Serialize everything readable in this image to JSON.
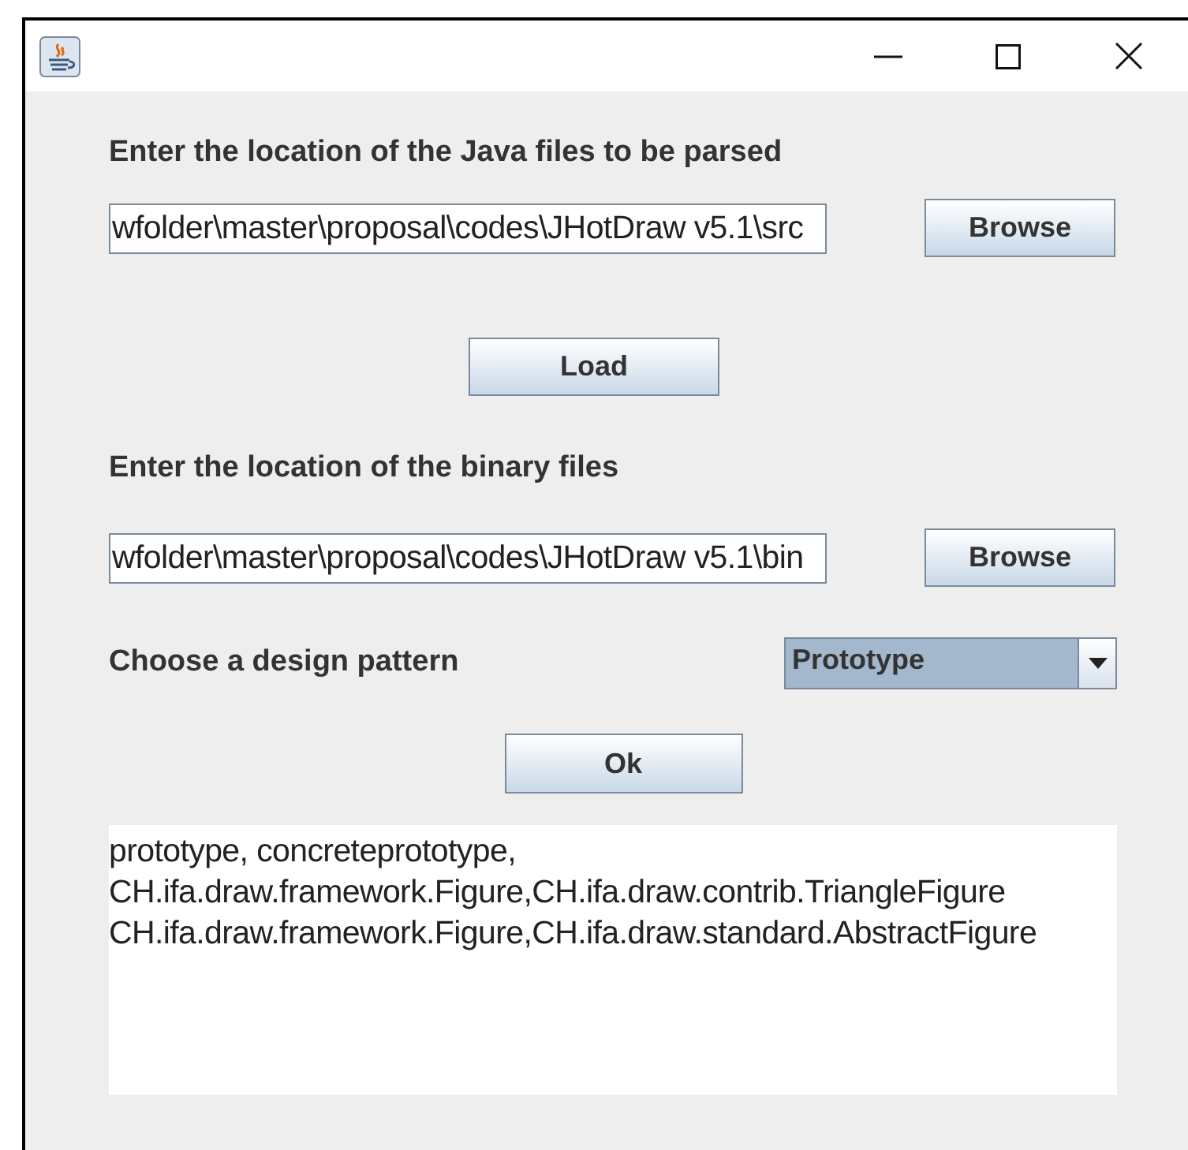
{
  "window": {
    "title_bar_buttons": [
      {
        "kind": "minimize"
      },
      {
        "kind": "maximize"
      },
      {
        "kind": "close"
      }
    ]
  },
  "source_section": {
    "label": "Enter the location of the Java files to be parsed",
    "path": "wfolder\\master\\proposal\\codes\\JHotDraw v5.1\\src",
    "browse_button": "Browse"
  },
  "load_button": "Load",
  "binary_section": {
    "label": "Enter the location of the binary files",
    "path": "wfolder\\master\\proposal\\codes\\JHotDraw v5.1\\bin",
    "browse_button": "Browse"
  },
  "pattern": {
    "label": "Choose a design pattern",
    "value": "Prototype"
  },
  "ok_button": "Ok",
  "output_lines": [
    "prototype, concreteprototype,",
    "CH.ifa.draw.framework.Figure,CH.ifa.draw.contrib.TriangleFigure",
    "CH.ifa.draw.framework.Figure,CH.ifa.draw.standard.AbstractFigure"
  ]
}
